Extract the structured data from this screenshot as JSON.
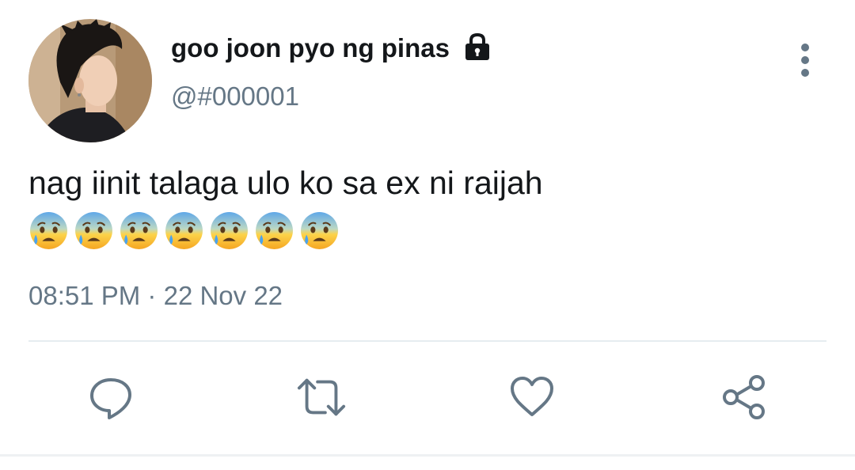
{
  "tweet": {
    "display_name": "goo joon pyo ng pinas",
    "handle": "@#000001",
    "text": "nag iinit talaga ulo ko sa ex ni raijah",
    "emoji_name": "anxious-face-with-sweat",
    "emoji_count": 7,
    "time": "08:51 PM",
    "separator": "·",
    "date": "22 Nov 22"
  },
  "icons": {
    "avatar": "profile-photo",
    "protected": "lock-icon",
    "more": "vertical-ellipsis-icon",
    "reply": "reply-icon",
    "retweet": "retweet-icon",
    "like": "heart-icon",
    "share": "share-icon"
  },
  "colors": {
    "text_primary": "#14171a",
    "text_secondary": "#657786",
    "icon": "#657786",
    "divider": "#e6ecf0"
  }
}
